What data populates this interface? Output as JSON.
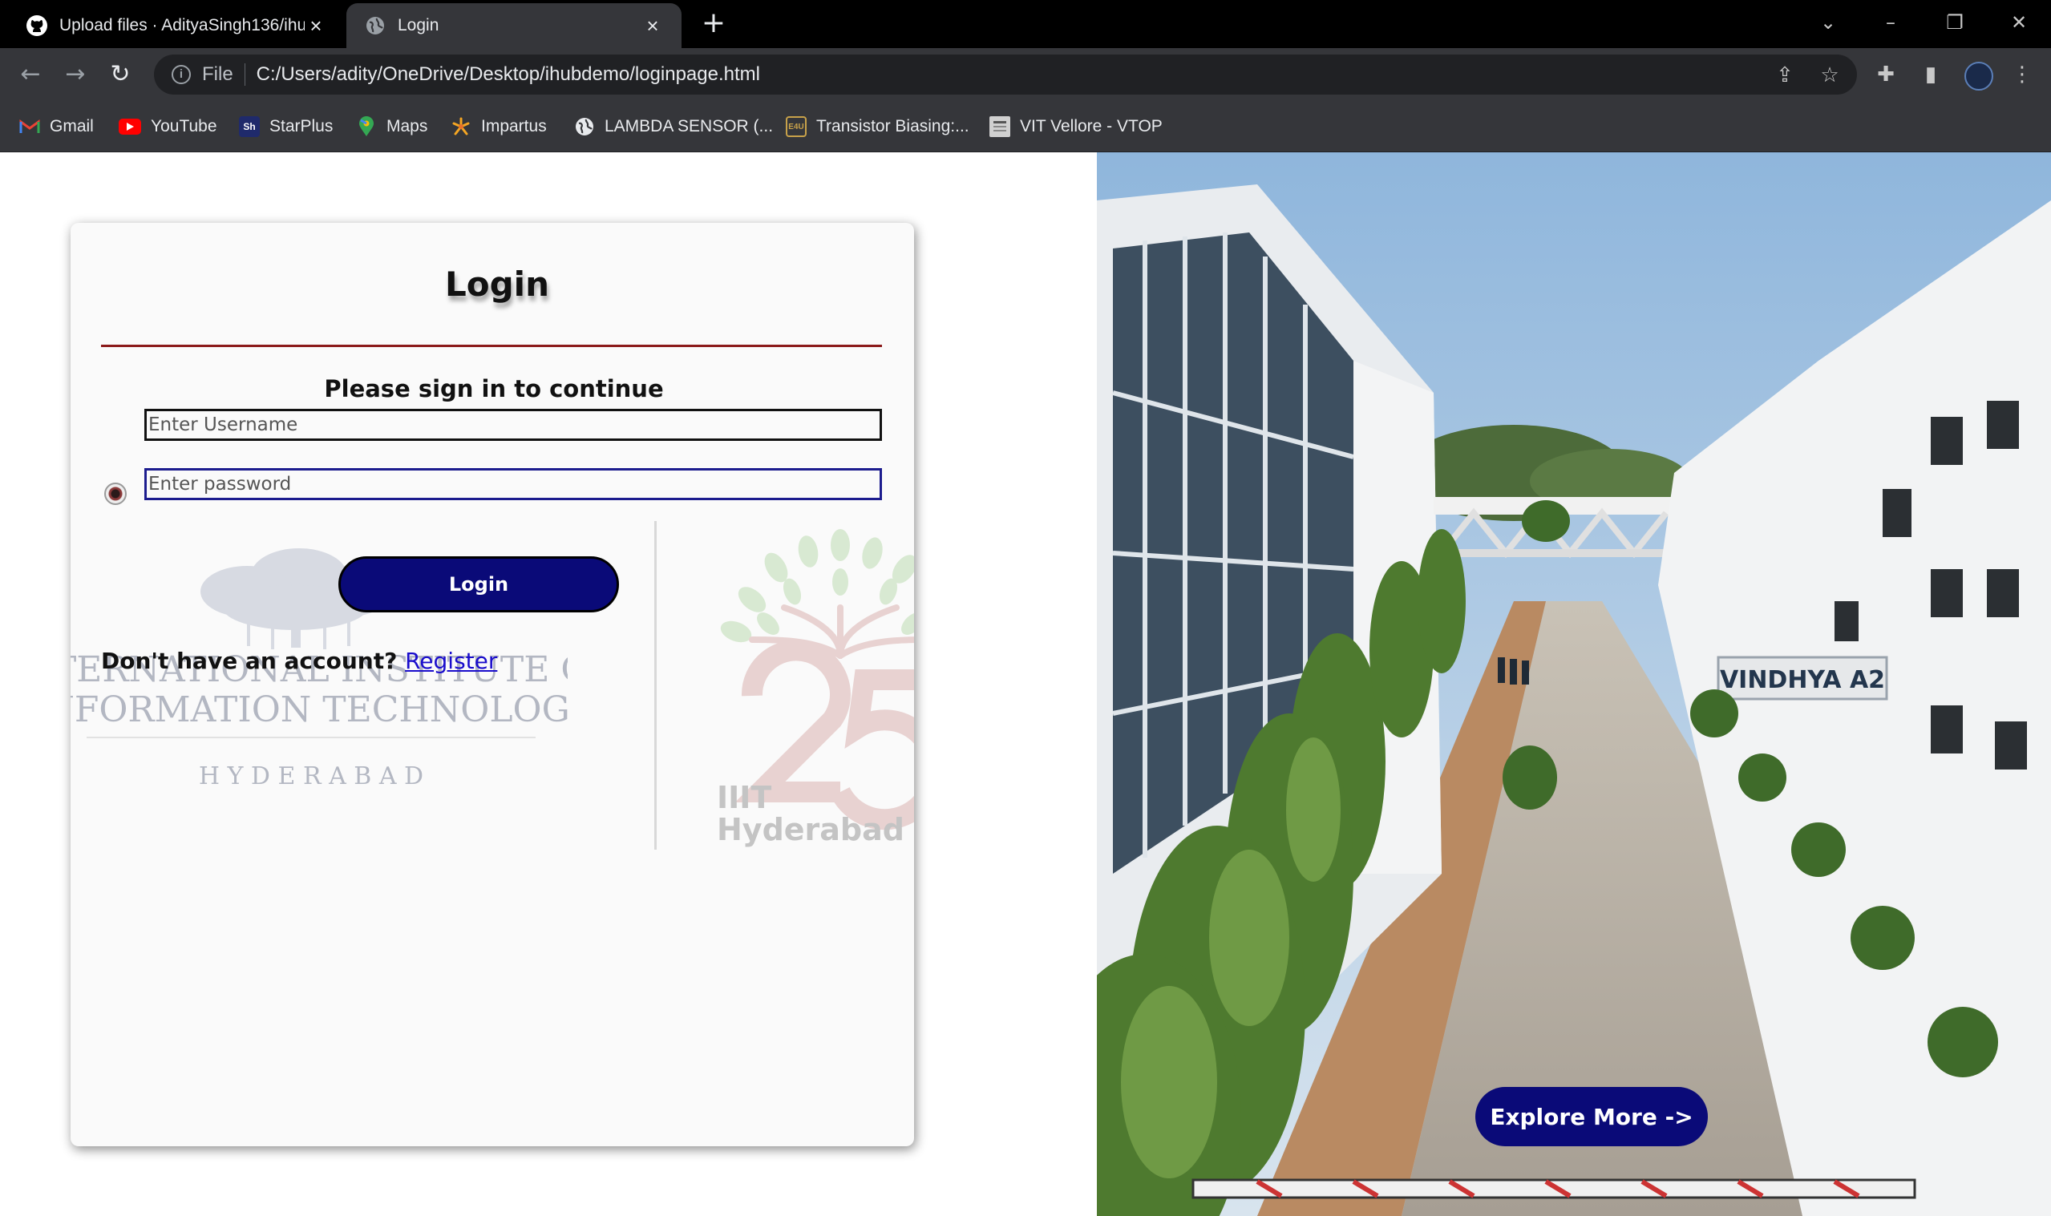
{
  "browser": {
    "tabs": [
      {
        "title": "Upload files · AdityaSingh136/ihu",
        "active": false,
        "icon": "github-icon"
      },
      {
        "title": "Login",
        "active": true,
        "icon": "globe-icon"
      }
    ],
    "address_scheme": "File",
    "address_url": "C:/Users/adity/OneDrive/Desktop/ihubdemo/loginpage.html",
    "bookmarks": [
      {
        "label": "Gmail",
        "icon": "gmail-icon",
        "color": "#ea4335"
      },
      {
        "label": "YouTube",
        "icon": "youtube-icon",
        "color": "#ff0000"
      },
      {
        "label": "StarPlus",
        "icon": "starplus-icon",
        "color": "#1f2a6b"
      },
      {
        "label": "Maps",
        "icon": "maps-icon",
        "color": "#34a853"
      },
      {
        "label": "Impartus",
        "icon": "impartus-icon",
        "color": "#f5a623"
      },
      {
        "label": "LAMBDA SENSOR (...",
        "icon": "globe-icon",
        "color": "#ffffff"
      },
      {
        "label": "Transistor Biasing:...",
        "icon": "e4u-icon",
        "color": "#c8a24a"
      },
      {
        "label": "VIT Vellore - VTOP",
        "icon": "vtop-icon",
        "color": "#b0b0b0"
      }
    ]
  },
  "login": {
    "title": "Login",
    "subtitle": "Please sign in to continue",
    "username_placeholder": "Enter Username",
    "password_placeholder": "Enter password",
    "button_label": "Login",
    "no_account_text": "Don't have an account? ",
    "register_label": "Register"
  },
  "watermarks": {
    "iiit_line1": "INTERNATIONAL INSTITUTE OF",
    "iiit_line2": "INFORMATION TECHNOLOGY",
    "iiit_line3": "H Y D E R A B A D",
    "logo_25_line1": "IIIT",
    "logo_25_line2": "Hyderabad"
  },
  "campus": {
    "sign_label": "VINDHYA A2",
    "explore_label": "Explore More ->"
  },
  "colors": {
    "accent_button": "#0a0a78",
    "divider": "#8b1a1a",
    "link": "#1a0dcc"
  }
}
